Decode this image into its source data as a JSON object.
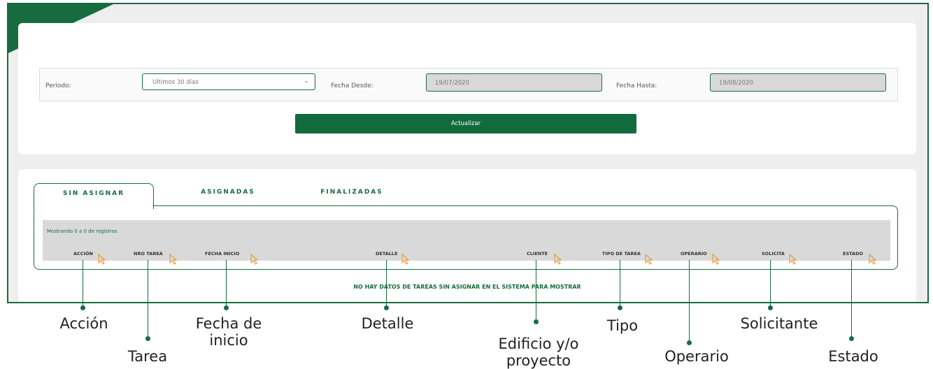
{
  "filters": {
    "periodo_label": "Periodo:",
    "periodo_value": "Ultimos 30 días",
    "desde_label": "Fecha Desde:",
    "desde_value": "19/07/2020",
    "hasta_label": "Fecha Hasta:",
    "hasta_value": "19/08/2020",
    "update_button": "Actualizar"
  },
  "tabs": [
    {
      "label": "SIN ASIGNAR",
      "active": true
    },
    {
      "label": "ASIGNADAS",
      "active": false
    },
    {
      "label": "FINALIZADAS",
      "active": false
    }
  ],
  "table": {
    "showing_text": "Mostrando 0 a 0 de registros",
    "columns": [
      "ACCIÓN",
      "NRO TAREA",
      "FECHA INICIO",
      "DETALLE",
      "CLIENTE",
      "TIPO DE TAREA",
      "OPERARIO",
      "SOLICITA",
      "ESTADO"
    ],
    "empty_message": "NO HAY DATOS DE TAREAS SIN ASIGNAR EN EL SISTEMA PARA MOSTRAR"
  },
  "annotations": [
    "Acción",
    "Tarea",
    "Fecha de inicio",
    "Detalle",
    "Edificio y/o proyecto",
    "Tipo",
    "Operario",
    "Solicitante",
    "Estado"
  ],
  "colors": {
    "accent": "#176c3f",
    "cursor": "#e8901f"
  }
}
